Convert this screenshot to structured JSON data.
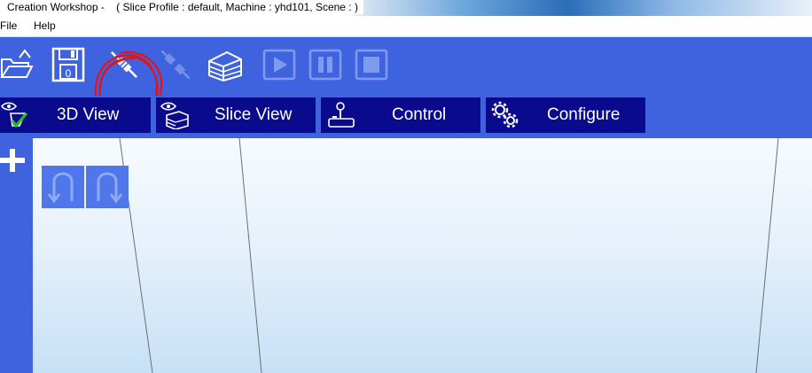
{
  "window": {
    "title": "Creation Workshop -    ( Slice Profile : default, Machine : yhd101, Scene : )"
  },
  "menu": {
    "items": [
      {
        "label": "File"
      },
      {
        "label": "Help"
      }
    ]
  },
  "toolbar": {
    "icons": [
      "open-folder-icon",
      "save-disk-icon",
      "connect-plug-icon",
      "disconnect-plug-icon",
      "slice-layers-icon",
      "play-icon",
      "pause-icon",
      "stop-icon"
    ],
    "save_badge": "0",
    "annotation_color": "#e0141a"
  },
  "tabs": [
    {
      "label": "3D View",
      "icon": "eye-cube-check-icon"
    },
    {
      "label": "Slice View",
      "icon": "eye-layers-icon"
    },
    {
      "label": "Control",
      "icon": "joystick-icon"
    },
    {
      "label": "Configure",
      "icon": "gears-icon"
    }
  ],
  "sidebar": {
    "icon": "plus-icon"
  },
  "viewport": {
    "buttons": [
      "undo-arrow-icon",
      "redo-arrow-icon"
    ]
  },
  "colors": {
    "toolbar_bg": "#3f63df",
    "tab_bg": "#0a0a8c",
    "icon_stroke": "#ffffff"
  }
}
